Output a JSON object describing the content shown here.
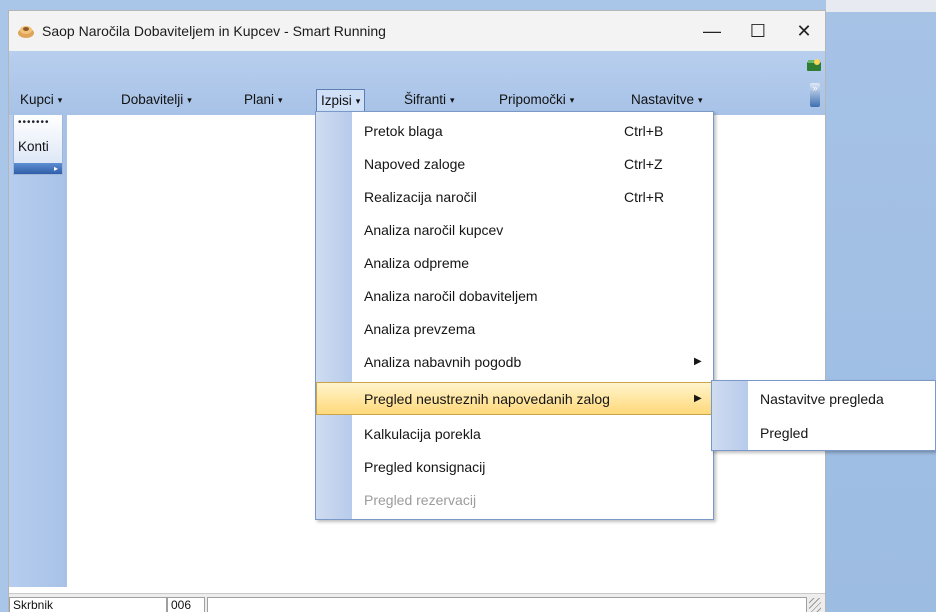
{
  "window": {
    "title": "Saop Naročila Dobaviteljem in Kupcev - Smart Running",
    "minimize": "—",
    "maximize": "☐",
    "close": "✕"
  },
  "menubar": [
    {
      "label": "Kupci",
      "caret": "▾"
    },
    {
      "label": "Dobavitelji",
      "caret": "▾"
    },
    {
      "label": "Plani",
      "caret": "▾"
    },
    {
      "label": "Izpisi",
      "caret": "▾"
    },
    {
      "label": "Šifranti",
      "caret": "▾"
    },
    {
      "label": "Pripomočki",
      "caret": "▾"
    },
    {
      "label": "Nastavitve",
      "caret": "▾"
    }
  ],
  "leftbar": {
    "dots": "•••••••",
    "konti_label": "Konti",
    "foot": "▸"
  },
  "dropdown": {
    "items": [
      {
        "label": "Pretok blaga",
        "shortcut": "Ctrl+B"
      },
      {
        "label": "Napoved zaloge",
        "shortcut": "Ctrl+Z"
      },
      {
        "label": "Realizacija naročil",
        "shortcut": "Ctrl+R"
      },
      {
        "label": "Analiza naročil kupcev"
      },
      {
        "label": "Analiza odpreme"
      },
      {
        "label": "Analiza naročil dobaviteljem"
      },
      {
        "label": "Analiza prevzema"
      },
      {
        "label": "Analiza nabavnih pogodb",
        "arrow": "▶"
      },
      {
        "label": "Pregled neustreznih napovedanih zalog",
        "arrow": "▶"
      },
      {
        "label": "Kalkulacija porekla"
      },
      {
        "label": "Pregled konsignacij"
      },
      {
        "label": "Pregled rezervacij"
      }
    ]
  },
  "submenu": {
    "items": [
      {
        "label": "Nastavitve pregleda"
      },
      {
        "label": "Pregled"
      }
    ]
  },
  "statusbar": {
    "user": "Skrbnik",
    "code": "006",
    "info": ""
  },
  "colors": {
    "accent_blue": "#a9c5e8",
    "highlight": "#ffd97a",
    "menu_border": "#7a98c8"
  }
}
